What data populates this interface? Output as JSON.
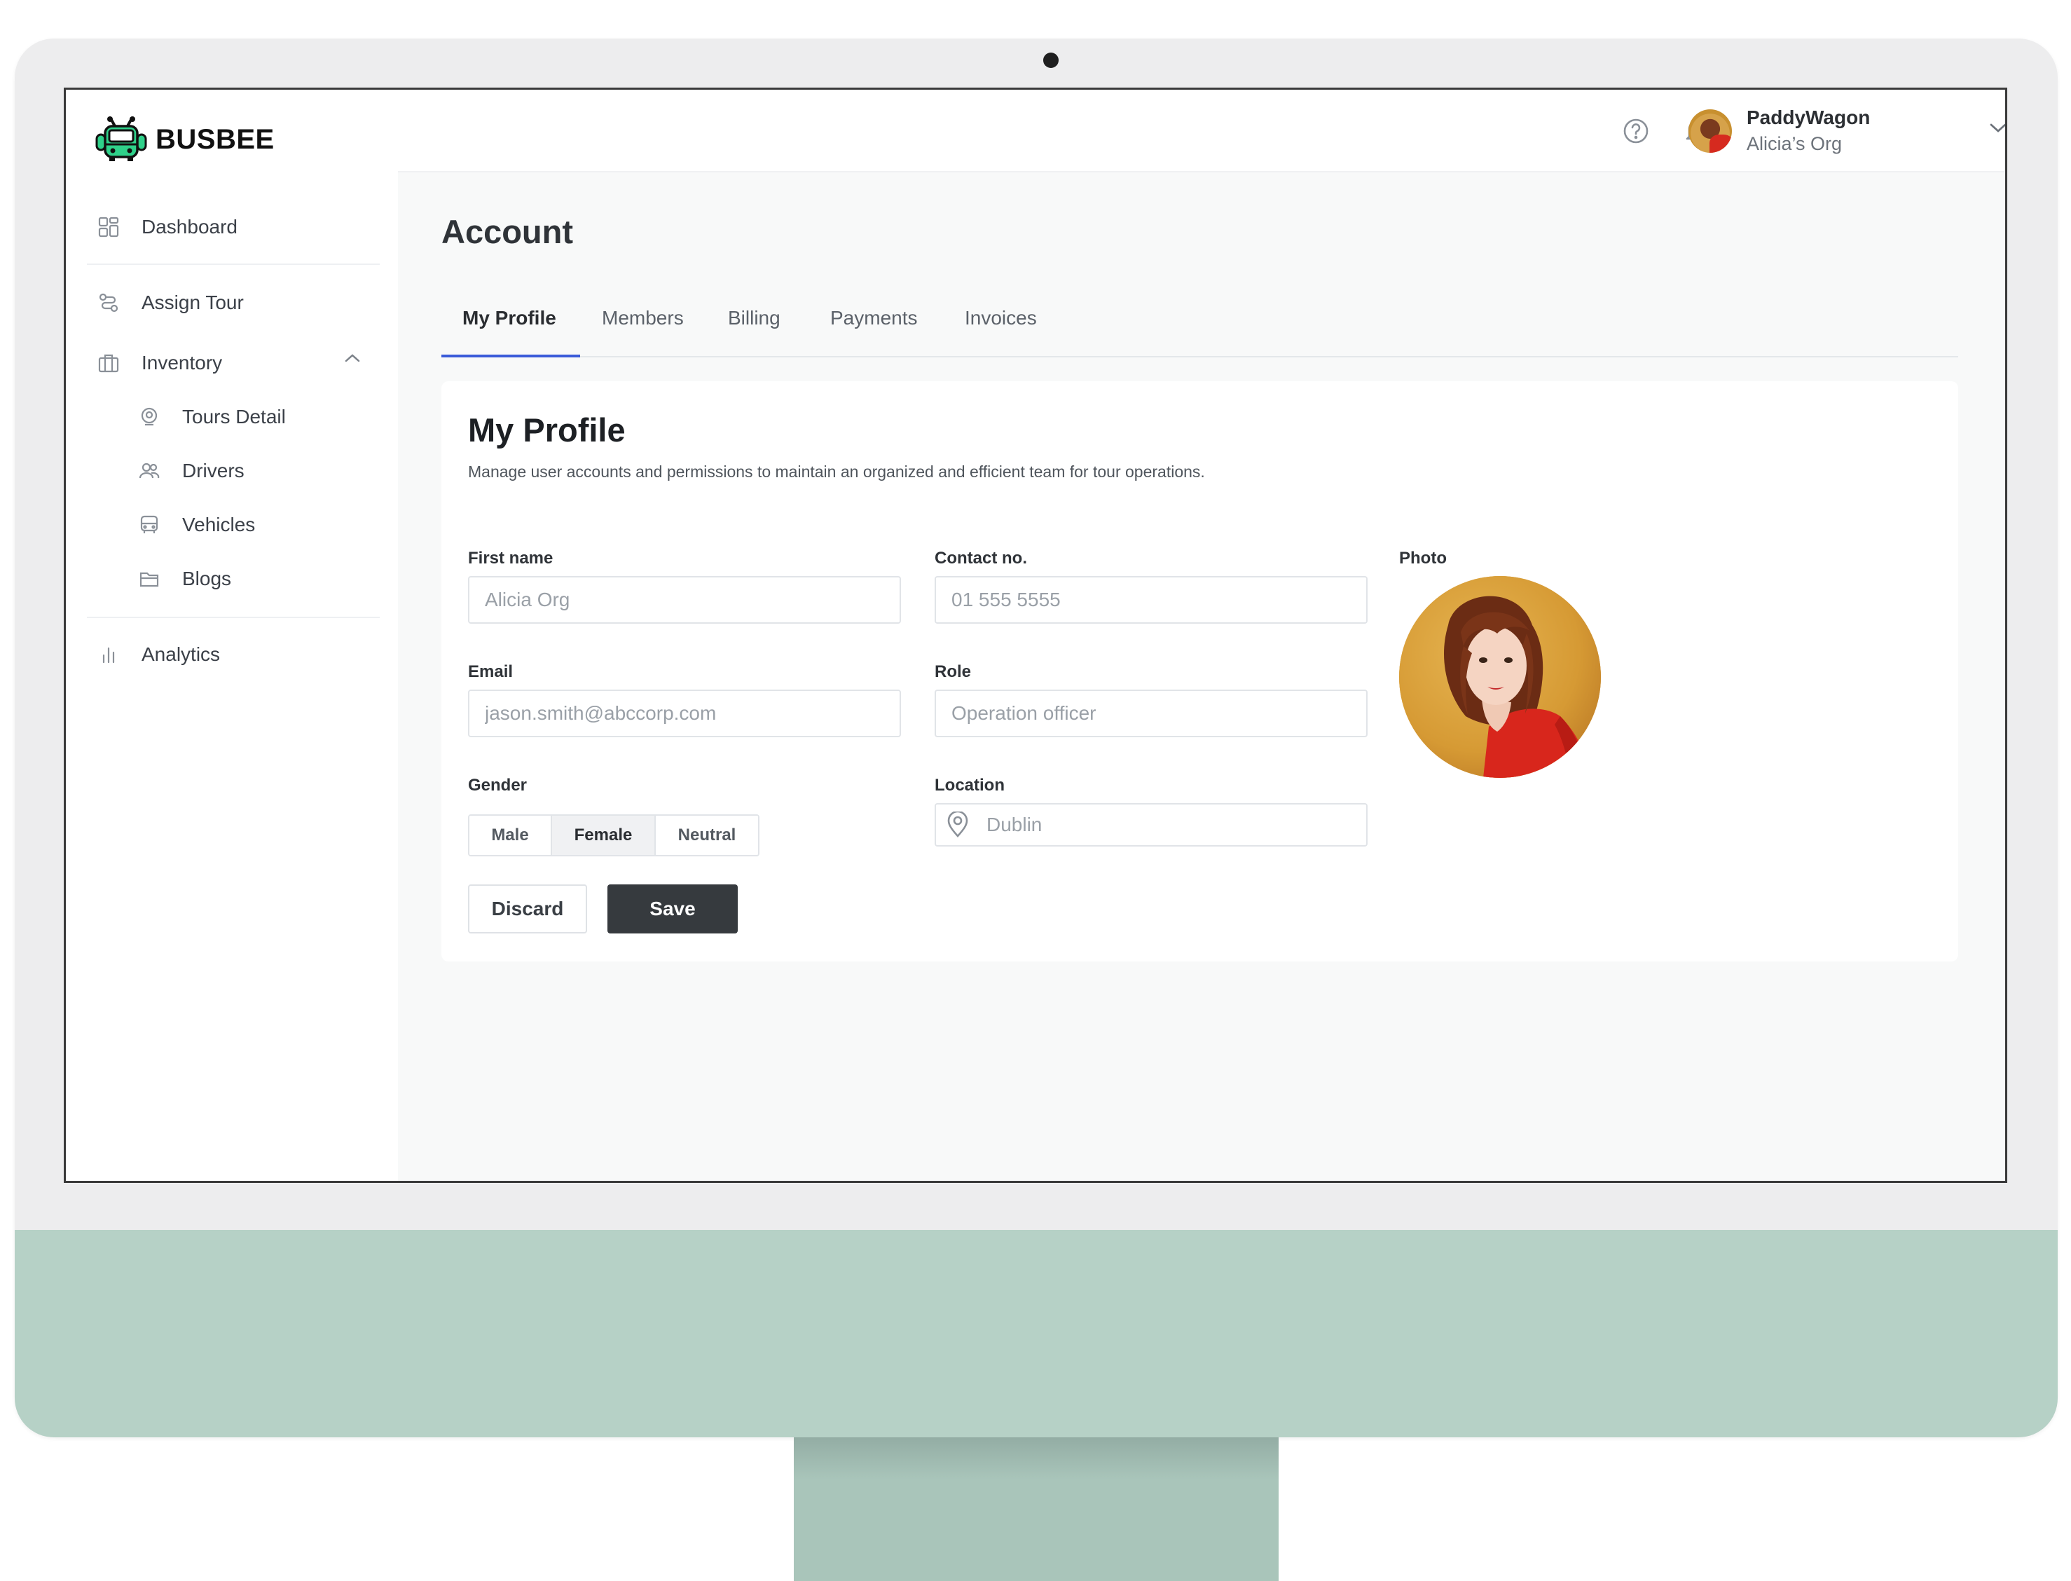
{
  "brand": {
    "name": "BUSBEE",
    "accent": "#3a5bd9",
    "logo_color": "#2fd18a"
  },
  "sidebar": {
    "items": [
      {
        "label": "Dashboard",
        "icon": "grid-icon"
      },
      {
        "label": "Assign Tour",
        "icon": "route-icon"
      },
      {
        "label": "Inventory",
        "icon": "briefcase-icon",
        "expanded": true
      },
      {
        "label": "Tours Detail",
        "icon": "map-pin-icon"
      },
      {
        "label": "Drivers",
        "icon": "users-icon"
      },
      {
        "label": "Vehicles",
        "icon": "bus-icon"
      },
      {
        "label": "Blogs",
        "icon": "folder-icon"
      },
      {
        "label": "Analytics",
        "icon": "bar-chart-icon"
      }
    ]
  },
  "topbar": {
    "user_name": "PaddyWagon",
    "org_name": "Alicia’s Org"
  },
  "page": {
    "title": "Account",
    "tabs": [
      {
        "label": "My Profile",
        "active": true
      },
      {
        "label": "Members"
      },
      {
        "label": "Billing"
      },
      {
        "label": "Payments"
      },
      {
        "label": "Invoices"
      }
    ]
  },
  "profile": {
    "title": "My Profile",
    "description": "Manage user accounts and permissions to maintain an organized and efficient team for tour operations.",
    "fields": {
      "first_name": {
        "label": "First name",
        "placeholder": "Alicia Org"
      },
      "contact": {
        "label": "Contact no.",
        "placeholder": "01 555 5555"
      },
      "email": {
        "label": "Email",
        "placeholder": "jason.smith@abccorp.com"
      },
      "role": {
        "label": "Role",
        "placeholder": "Operation officer"
      },
      "location": {
        "label": "Location",
        "placeholder": "Dublin"
      }
    },
    "gender": {
      "label": "Gender",
      "options": [
        "Male",
        "Female",
        "Neutral"
      ],
      "selected": "Female"
    },
    "photo_label": "Photo",
    "discard_label": "Discard",
    "save_label": "Save"
  }
}
